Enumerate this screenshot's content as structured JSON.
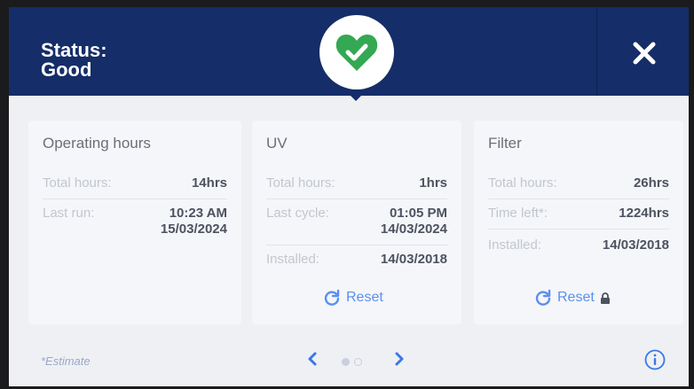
{
  "header": {
    "status_label": "Status:",
    "status_value": "Good",
    "status_icon": "heart-check-icon",
    "close_icon": "close-icon"
  },
  "cards": {
    "operating": {
      "title": "Operating hours",
      "total_label": "Total hours:",
      "total_value": "14hrs",
      "last_label": "Last run:",
      "last_time": "10:23 AM",
      "last_date": "15/03/2024"
    },
    "uv": {
      "title": "UV",
      "total_label": "Total hours:",
      "total_value": "1hrs",
      "last_label": "Last cycle:",
      "last_time": "01:05 PM",
      "last_date": "14/03/2024",
      "installed_label": "Installed:",
      "installed_value": "14/03/2018",
      "reset_label": "Reset"
    },
    "filter": {
      "title": "Filter",
      "total_label": "Total hours:",
      "total_value": "26hrs",
      "left_label": "Time left*:",
      "left_value": "1224hrs",
      "installed_label": "Installed:",
      "installed_value": "14/03/2018",
      "reset_label": "Reset",
      "lock_icon": "lock-icon"
    }
  },
  "footer": {
    "estimate_note": "*Estimate",
    "prev_icon": "chevron-left-icon",
    "next_icon": "chevron-right-icon",
    "info_icon": "info-icon",
    "page_current": 1,
    "page_total": 2
  },
  "colors": {
    "header_bg": "#152d68",
    "accent_blue": "#3a78e6",
    "status_green": "#34a853"
  }
}
